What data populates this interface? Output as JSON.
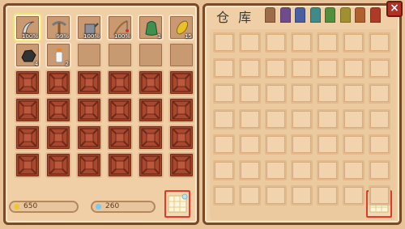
{
  "inventory": {
    "items": [
      {
        "icon": "scythe-icon",
        "qty": "100%"
      },
      {
        "icon": "pickaxe-icon",
        "qty": "99%"
      },
      {
        "icon": "watering-can-icon",
        "qty": "100%"
      },
      {
        "icon": "fishing-rod-icon",
        "qty": "100%"
      },
      {
        "icon": "seed-bag-icon",
        "qty": "1"
      },
      {
        "icon": "corn-icon",
        "qty": "15"
      },
      {
        "icon": "coal-icon",
        "qty": "4"
      },
      {
        "icon": "milk-bottle-icon",
        "qty": "2"
      }
    ],
    "gold": "650",
    "gems": "260"
  },
  "warehouse": {
    "title": "仓 库",
    "close": "×",
    "tab_colors": [
      "#9b6b4a",
      "#6f4c8c",
      "#4a5fa0",
      "#3f8a8a",
      "#4f8f3e",
      "#a1902f",
      "#b0602c",
      "#b03a2a"
    ]
  },
  "colors": {
    "gold": "#f3c52a",
    "gem": "#7fc9e6"
  }
}
